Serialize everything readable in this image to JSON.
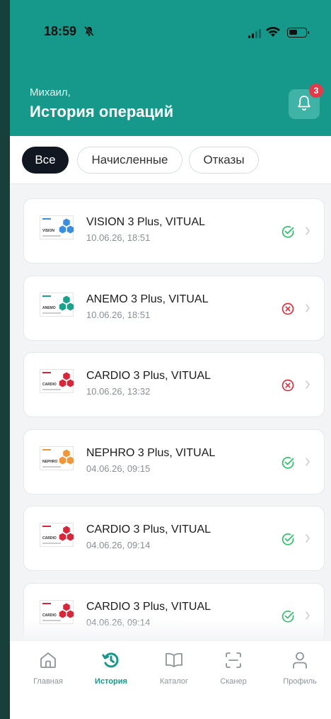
{
  "status_bar": {
    "time": "18:59"
  },
  "header": {
    "greeting": "Михаил,",
    "title": "История операций",
    "notifications_count": "3"
  },
  "filters": [
    {
      "label": "Все",
      "active": true
    },
    {
      "label": "Начисленные",
      "active": false
    },
    {
      "label": "Отказы",
      "active": false
    }
  ],
  "operations": [
    {
      "name": "VISION 3 Plus, VITUAL",
      "date": "10.06.26, 18:51",
      "status": "success",
      "box_label": "VISION",
      "color": "#3a8ee0"
    },
    {
      "name": "ANEMO 3 Plus, VITUAL",
      "date": "10.06.26, 18:51",
      "status": "rejected",
      "box_label": "ANEMO",
      "color": "#1aa38a"
    },
    {
      "name": "CARDIO 3 Plus, VITUAL",
      "date": "10.06.26, 13:32",
      "status": "rejected",
      "box_label": "CARDIO",
      "color": "#d8263a"
    },
    {
      "name": "NEPHRO 3 Plus, VITUAL",
      "date": "04.06.26, 09:15",
      "status": "success",
      "box_label": "NEPHRO",
      "color": "#f0973a"
    },
    {
      "name": "CARDIO 3 Plus, VITUAL",
      "date": "04.06.26, 09:14",
      "status": "success",
      "box_label": "CARDIO",
      "color": "#d8263a"
    },
    {
      "name": "CARDIO 3 Plus, VITUAL",
      "date": "04.06.26, 09:14",
      "status": "success",
      "box_label": "CARDIO",
      "color": "#d8263a"
    }
  ],
  "tabbar": [
    {
      "label": "Главная",
      "icon": "home-icon",
      "active": false
    },
    {
      "label": "История",
      "icon": "history-icon",
      "active": true
    },
    {
      "label": "Каталог",
      "icon": "book-icon",
      "active": false
    },
    {
      "label": "Сканер",
      "icon": "scan-icon",
      "active": false
    },
    {
      "label": "Профиль",
      "icon": "profile-icon",
      "active": false
    }
  ],
  "colors": {
    "accent": "#16998b",
    "success": "#2fc06b",
    "danger": "#e0303f",
    "chip_active": "#101720"
  }
}
